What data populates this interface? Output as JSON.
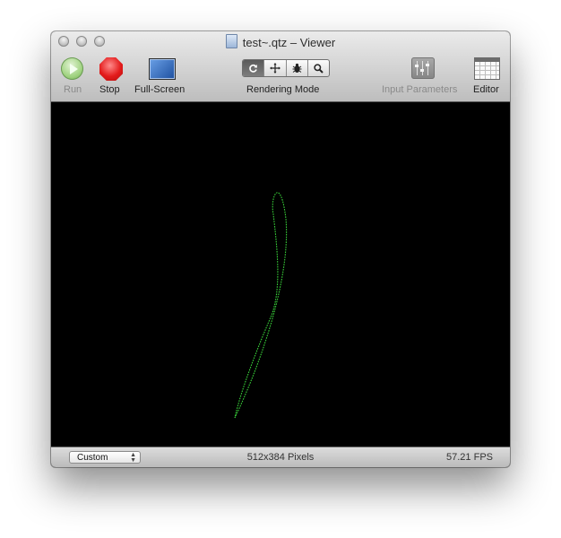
{
  "window": {
    "title": "test~.qtz – Viewer"
  },
  "toolbar": {
    "run_label": "Run",
    "stop_label": "Stop",
    "fullscreen_label": "Full-Screen",
    "rendering_mode_label": "Rendering Mode",
    "rendering_mode_options": [
      "rotate-icon",
      "move-icon",
      "debug-bug-icon",
      "zoom-icon"
    ],
    "input_parameters_label": "Input Parameters",
    "editor_label": "Editor"
  },
  "status": {
    "size_preset": "Custom",
    "dimensions": "512x384 Pixels",
    "fps": "57.21 FPS"
  },
  "colors": {
    "curve": "#39d23a",
    "canvas": "#000000",
    "stop": "#e31b1b",
    "run": "#9fd27f"
  }
}
